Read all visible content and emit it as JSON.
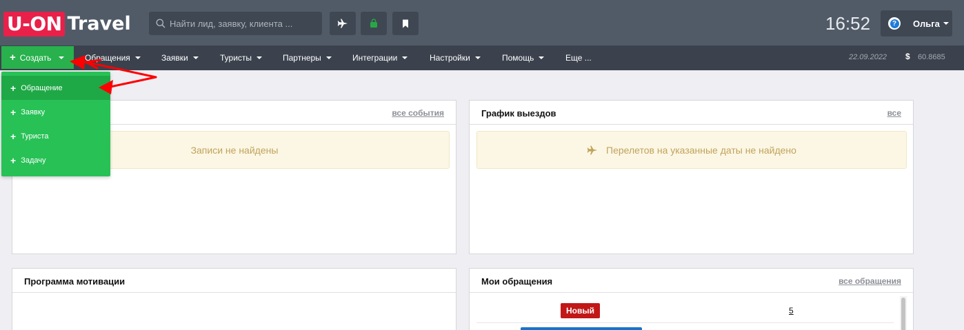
{
  "header": {
    "logo_part1": "U-ON",
    "logo_part2": "Travel",
    "search_placeholder": "Найти лид, заявку, клиента ...",
    "time": "16:52",
    "user_name": "Ольга"
  },
  "nav": {
    "create_label": "Создать",
    "items": [
      "Обращения",
      "Заявки",
      "Туристы",
      "Партнеры",
      "Интеграции",
      "Настройки",
      "Помощь",
      "Еще ..."
    ],
    "date": "22.09.2022",
    "currency_symbol": "$",
    "rate": "60.8685"
  },
  "create_menu": {
    "items": [
      "Обращение",
      "Заявку",
      "Туриста",
      "Задачу"
    ],
    "active_index": 0
  },
  "panels": {
    "events": {
      "link": "все события",
      "empty_text": "Записи не найдены"
    },
    "departures": {
      "title": "График выездов",
      "link": "все",
      "empty_text": "Перелетов на указанные даты не найдено"
    },
    "motivation": {
      "title": "Программа мотивации"
    },
    "my_requests": {
      "title": "Мои обращения",
      "link": "все обращения",
      "rows": [
        {
          "status": "Новый",
          "count": "5"
        }
      ]
    }
  },
  "colors": {
    "header_bg": "#515b68",
    "nav_bg": "#3b424d",
    "create_green": "#28b14c",
    "dropdown_green": "#28c156",
    "logo_red": "#e8204a",
    "badge_red": "#c21717",
    "empty_bg": "#fcf7e4",
    "empty_text": "#c0a25c",
    "annotation_arrow": "#ff0000"
  },
  "icons": {
    "search": "search-icon",
    "plane": "plane-icon",
    "bag": "bag-icon",
    "bookmark": "bookmark-icon",
    "help": "help-icon"
  }
}
